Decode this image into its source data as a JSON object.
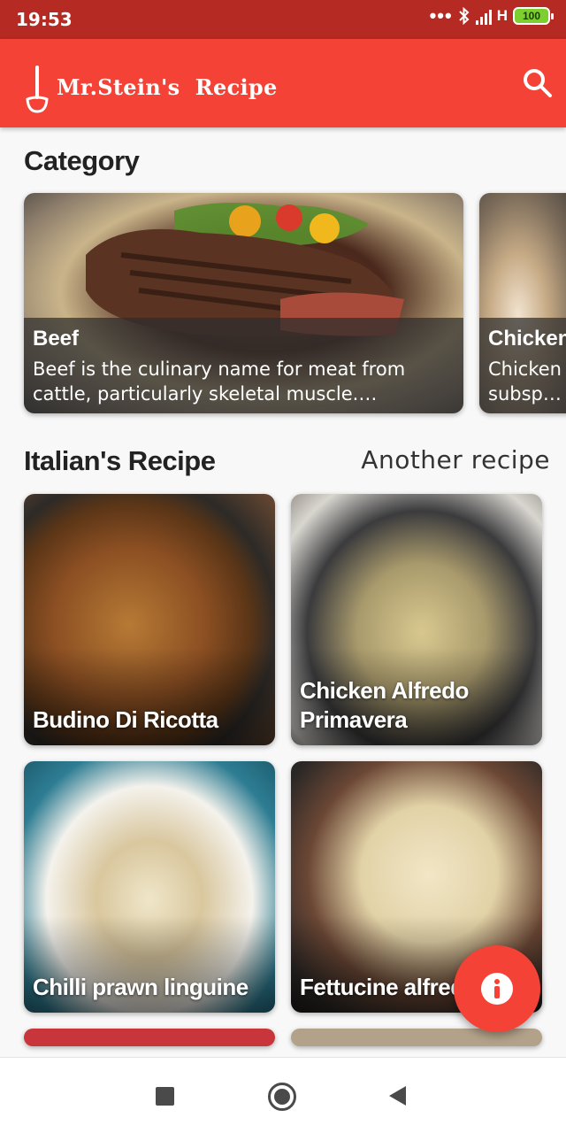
{
  "status_bar": {
    "time": "19:53",
    "network": "H",
    "battery": "100"
  },
  "app_bar": {
    "title": "Mr.Stein's  Recipe",
    "logo_icon": "ladle-icon",
    "search_icon": "search-icon",
    "color": "#f44336"
  },
  "category_section": {
    "title": "Category",
    "cards": [
      {
        "name": "Beef",
        "description": "Beef is the culinary name for meat from cattle, particularly skeletal muscle. Humans..."
      },
      {
        "name": "Chicken",
        "description": "Chicken subspecies"
      }
    ]
  },
  "italian_section": {
    "title": "Italian's Recipe",
    "another_link": "Another recipe",
    "recipes": [
      {
        "name": "Budino Di Ricotta"
      },
      {
        "name": "Chicken Alfredo Primavera"
      },
      {
        "name": "Chilli prawn linguine"
      },
      {
        "name": "Fettucine alfredo"
      }
    ]
  },
  "fab": {
    "icon": "info-icon",
    "color": "#f44336"
  },
  "nav_bar": {
    "recents_icon": "square-icon",
    "home_icon": "circle-icon",
    "back_icon": "triangle-back-icon"
  }
}
